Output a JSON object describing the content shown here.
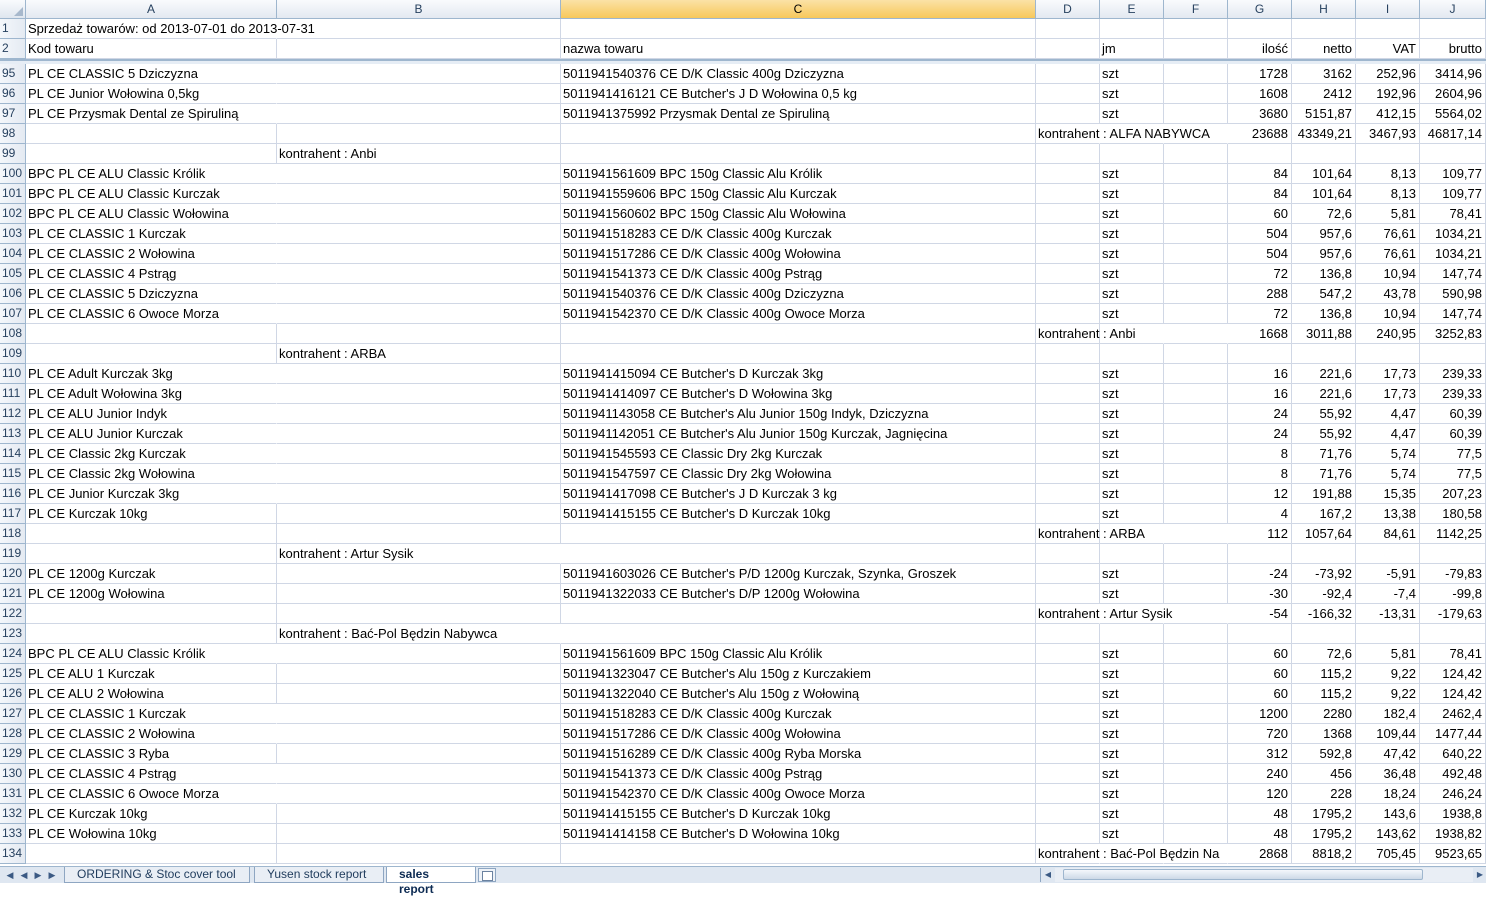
{
  "columns": [
    "A",
    "B",
    "C",
    "D",
    "E",
    "F",
    "G",
    "H",
    "I",
    "J"
  ],
  "selected_column": "C",
  "top_rows": [
    {
      "n": "1",
      "a": "Sprzedaż towarów: od 2013-07-01 do 2013-07-31",
      "b": "",
      "c": "",
      "d": "",
      "e": "",
      "g": "",
      "h": "",
      "i": "",
      "j": ""
    },
    {
      "n": "2",
      "a": "Kod towaru",
      "b": "",
      "c": "nazwa towaru",
      "d": "",
      "e": "jm",
      "g": "ilość",
      "h": "netto",
      "i": "VAT",
      "j": "brutto"
    }
  ],
  "rows": [
    {
      "n": "95",
      "a": "PL CE CLASSIC 5 Dziczyzna",
      "b": "",
      "c": "5011941540376 CE D/K Classic 400g Dziczyzna",
      "d": "",
      "e": "szt",
      "g": "1728",
      "h": "3162",
      "i": "252,96",
      "j": "3414,96"
    },
    {
      "n": "96",
      "a": "PL CE Junior Wołowina 0,5kg",
      "b": "",
      "c": "5011941416121 CE Butcher's J D Wołowina 0,5 kg",
      "d": "",
      "e": "szt",
      "g": "1608",
      "h": "2412",
      "i": "192,96",
      "j": "2604,96"
    },
    {
      "n": "97",
      "a": "PL CE Przysmak Dental ze Spiruliną",
      "b": "",
      "c": "5011941375992 Przysmak Dental ze Spiruliną",
      "d": "",
      "e": "szt",
      "g": "3680",
      "h": "5151,87",
      "i": "412,15",
      "j": "5564,02"
    },
    {
      "n": "98",
      "a": "",
      "b": "",
      "c": "",
      "d": "kontrahent : ALFA NABYWCA",
      "e": "",
      "g": "23688",
      "h": "43349,21",
      "i": "3467,93",
      "j": "46817,14"
    },
    {
      "n": "99",
      "a": "",
      "b": "kontrahent : Anbi",
      "c": "",
      "d": "",
      "e": "",
      "g": "",
      "h": "",
      "i": "",
      "j": ""
    },
    {
      "n": "100",
      "a": "BPC PL CE ALU Classic Królik",
      "b": "",
      "c": "5011941561609 BPC 150g Classic Alu Królik",
      "d": "",
      "e": "szt",
      "g": "84",
      "h": "101,64",
      "i": "8,13",
      "j": "109,77"
    },
    {
      "n": "101",
      "a": "BPC PL CE ALU Classic Kurczak",
      "b": "",
      "c": "5011941559606 BPC 150g Classic Alu Kurczak",
      "d": "",
      "e": "szt",
      "g": "84",
      "h": "101,64",
      "i": "8,13",
      "j": "109,77"
    },
    {
      "n": "102",
      "a": "BPC PL CE ALU Classic Wołowina",
      "b": "",
      "c": "5011941560602 BPC 150g Classic Alu Wołowina",
      "d": "",
      "e": "szt",
      "g": "60",
      "h": "72,6",
      "i": "5,81",
      "j": "78,41"
    },
    {
      "n": "103",
      "a": "PL CE CLASSIC 1 Kurczak",
      "b": "",
      "c": "5011941518283 CE D/K Classic 400g Kurczak",
      "d": "",
      "e": "szt",
      "g": "504",
      "h": "957,6",
      "i": "76,61",
      "j": "1034,21"
    },
    {
      "n": "104",
      "a": "PL CE CLASSIC 2 Wołowina",
      "b": "",
      "c": "5011941517286 CE D/K Classic 400g Wołowina",
      "d": "",
      "e": "szt",
      "g": "504",
      "h": "957,6",
      "i": "76,61",
      "j": "1034,21"
    },
    {
      "n": "105",
      "a": "PL CE CLASSIC 4 Pstrąg",
      "b": "",
      "c": "5011941541373 CE D/K Classic 400g Pstrąg",
      "d": "",
      "e": "szt",
      "g": "72",
      "h": "136,8",
      "i": "10,94",
      "j": "147,74"
    },
    {
      "n": "106",
      "a": "PL CE CLASSIC 5 Dziczyzna",
      "b": "",
      "c": "5011941540376 CE D/K Classic 400g Dziczyzna",
      "d": "",
      "e": "szt",
      "g": "288",
      "h": "547,2",
      "i": "43,78",
      "j": "590,98"
    },
    {
      "n": "107",
      "a": "PL CE CLASSIC 6 Owoce Morza",
      "b": "",
      "c": "5011941542370 CE D/K Classic 400g Owoce Morza",
      "d": "",
      "e": "szt",
      "g": "72",
      "h": "136,8",
      "i": "10,94",
      "j": "147,74"
    },
    {
      "n": "108",
      "a": "",
      "b": "",
      "c": "",
      "d": "kontrahent : Anbi",
      "e": "",
      "g": "1668",
      "h": "3011,88",
      "i": "240,95",
      "j": "3252,83"
    },
    {
      "n": "109",
      "a": "",
      "b": "kontrahent : ARBA",
      "c": "",
      "d": "",
      "e": "",
      "g": "",
      "h": "",
      "i": "",
      "j": ""
    },
    {
      "n": "110",
      "a": "PL CE Adult Kurczak 3kg",
      "b": "",
      "c": "5011941415094 CE Butcher's D Kurczak 3kg",
      "d": "",
      "e": "szt",
      "g": "16",
      "h": "221,6",
      "i": "17,73",
      "j": "239,33"
    },
    {
      "n": "111",
      "a": "PL CE Adult Wołowina 3kg",
      "b": "",
      "c": "5011941414097 CE Butcher's D Wołowina 3kg",
      "d": "",
      "e": "szt",
      "g": "16",
      "h": "221,6",
      "i": "17,73",
      "j": "239,33"
    },
    {
      "n": "112",
      "a": "PL CE ALU Junior Indyk",
      "b": "",
      "c": "5011941143058 CE Butcher's Alu Junior 150g Indyk, Dziczyzna",
      "d": "",
      "e": "szt",
      "g": "24",
      "h": "55,92",
      "i": "4,47",
      "j": "60,39"
    },
    {
      "n": "113",
      "a": "PL CE ALU Junior Kurczak",
      "b": "",
      "c": "5011941142051 CE Butcher's Alu Junior 150g Kurczak, Jagnięcina",
      "d": "",
      "e": "szt",
      "g": "24",
      "h": "55,92",
      "i": "4,47",
      "j": "60,39"
    },
    {
      "n": "114",
      "a": "PL CE Classic 2kg Kurczak",
      "b": "",
      "c": "5011941545593 CE Classic Dry 2kg Kurczak",
      "d": "",
      "e": "szt",
      "g": "8",
      "h": "71,76",
      "i": "5,74",
      "j": "77,5"
    },
    {
      "n": "115",
      "a": "PL CE Classic 2kg Wołowina",
      "b": "",
      "c": "5011941547597 CE Classic Dry 2kg Wołowina",
      "d": "",
      "e": "szt",
      "g": "8",
      "h": "71,76",
      "i": "5,74",
      "j": "77,5"
    },
    {
      "n": "116",
      "a": "PL CE Junior Kurczak 3kg",
      "b": "",
      "c": "5011941417098 CE Butcher's J D Kurczak 3 kg",
      "d": "",
      "e": "szt",
      "g": "12",
      "h": "191,88",
      "i": "15,35",
      "j": "207,23"
    },
    {
      "n": "117",
      "a": "PL CE Kurczak 10kg",
      "b": "",
      "c": "5011941415155 CE Butcher's D Kurczak 10kg",
      "d": "",
      "e": "szt",
      "g": "4",
      "h": "167,2",
      "i": "13,38",
      "j": "180,58"
    },
    {
      "n": "118",
      "a": "",
      "b": "",
      "c": "",
      "d": "kontrahent : ARBA",
      "e": "",
      "g": "112",
      "h": "1057,64",
      "i": "84,61",
      "j": "1142,25"
    },
    {
      "n": "119",
      "a": "",
      "b": "kontrahent : Artur Sysik",
      "c": "",
      "d": "",
      "e": "",
      "g": "",
      "h": "",
      "i": "",
      "j": ""
    },
    {
      "n": "120",
      "a": "PL CE 1200g Kurczak",
      "b": "",
      "c": "5011941603026 CE Butcher's P/D 1200g Kurczak, Szynka, Groszek",
      "d": "",
      "e": "szt",
      "g": "-24",
      "h": "-73,92",
      "i": "-5,91",
      "j": "-79,83"
    },
    {
      "n": "121",
      "a": "PL CE 1200g Wołowina",
      "b": "",
      "c": "5011941322033 CE Butcher's D/P 1200g Wołowina",
      "d": "",
      "e": "szt",
      "g": "-30",
      "h": "-92,4",
      "i": "-7,4",
      "j": "-99,8"
    },
    {
      "n": "122",
      "a": "",
      "b": "",
      "c": "",
      "d": "kontrahent : Artur Sysik",
      "e": "",
      "g": "-54",
      "h": "-166,32",
      "i": "-13,31",
      "j": "-179,63"
    },
    {
      "n": "123",
      "a": "",
      "b": "kontrahent : Bać-Pol Będzin Nabywca",
      "c": "",
      "d": "",
      "e": "",
      "g": "",
      "h": "",
      "i": "",
      "j": ""
    },
    {
      "n": "124",
      "a": "BPC PL CE ALU Classic Królik",
      "b": "",
      "c": "5011941561609 BPC 150g Classic Alu Królik",
      "d": "",
      "e": "szt",
      "g": "60",
      "h": "72,6",
      "i": "5,81",
      "j": "78,41"
    },
    {
      "n": "125",
      "a": "PL CE ALU 1 Kurczak",
      "b": "",
      "c": "5011941323047 CE Butcher's Alu 150g z Kurczakiem",
      "d": "",
      "e": "szt",
      "g": "60",
      "h": "115,2",
      "i": "9,22",
      "j": "124,42"
    },
    {
      "n": "126",
      "a": "PL CE ALU 2 Wołowina",
      "b": "",
      "c": "5011941322040 CE Butcher's Alu 150g z Wołowiną",
      "d": "",
      "e": "szt",
      "g": "60",
      "h": "115,2",
      "i": "9,22",
      "j": "124,42"
    },
    {
      "n": "127",
      "a": "PL CE CLASSIC 1 Kurczak",
      "b": "",
      "c": "5011941518283 CE D/K Classic 400g Kurczak",
      "d": "",
      "e": "szt",
      "g": "1200",
      "h": "2280",
      "i": "182,4",
      "j": "2462,4"
    },
    {
      "n": "128",
      "a": "PL CE CLASSIC 2 Wołowina",
      "b": "",
      "c": "5011941517286 CE D/K Classic 400g Wołowina",
      "d": "",
      "e": "szt",
      "g": "720",
      "h": "1368",
      "i": "109,44",
      "j": "1477,44"
    },
    {
      "n": "129",
      "a": "PL CE CLASSIC 3 Ryba",
      "b": "",
      "c": "5011941516289 CE D/K Classic 400g Ryba Morska",
      "d": "",
      "e": "szt",
      "g": "312",
      "h": "592,8",
      "i": "47,42",
      "j": "640,22"
    },
    {
      "n": "130",
      "a": "PL CE CLASSIC 4 Pstrąg",
      "b": "",
      "c": "5011941541373 CE D/K Classic 400g Pstrąg",
      "d": "",
      "e": "szt",
      "g": "240",
      "h": "456",
      "i": "36,48",
      "j": "492,48"
    },
    {
      "n": "131",
      "a": "PL CE CLASSIC 6 Owoce Morza",
      "b": "",
      "c": "5011941542370 CE D/K Classic 400g Owoce Morza",
      "d": "",
      "e": "szt",
      "g": "120",
      "h": "228",
      "i": "18,24",
      "j": "246,24"
    },
    {
      "n": "132",
      "a": "PL CE Kurczak 10kg",
      "b": "",
      "c": "5011941415155 CE Butcher's D Kurczak 10kg",
      "d": "",
      "e": "szt",
      "g": "48",
      "h": "1795,2",
      "i": "143,6",
      "j": "1938,8"
    },
    {
      "n": "133",
      "a": "PL CE Wołowina 10kg",
      "b": "",
      "c": "5011941414158 CE Butcher's D Wołowina 10kg",
      "d": "",
      "e": "szt",
      "g": "48",
      "h": "1795,2",
      "i": "143,62",
      "j": "1938,82"
    },
    {
      "n": "134",
      "a": "",
      "b": "",
      "c": "",
      "d": "kontrahent : Bać-Pol Będzin Na",
      "e": "",
      "g": "2868",
      "h": "8818,2",
      "i": "705,45",
      "j": "9523,65"
    }
  ],
  "sheet_tabs": [
    {
      "label": "ORDERING & Stoc cover tool",
      "active": false
    },
    {
      "label": "Yusen stock report",
      "active": false
    },
    {
      "label": "sales report",
      "active": true
    }
  ],
  "icons": {
    "nav_first": "first-sheet-icon",
    "nav_prev": "prev-sheet-icon",
    "nav_next": "next-sheet-icon",
    "nav_last": "last-sheet-icon",
    "new_sheet": "insert-worksheet-icon"
  }
}
